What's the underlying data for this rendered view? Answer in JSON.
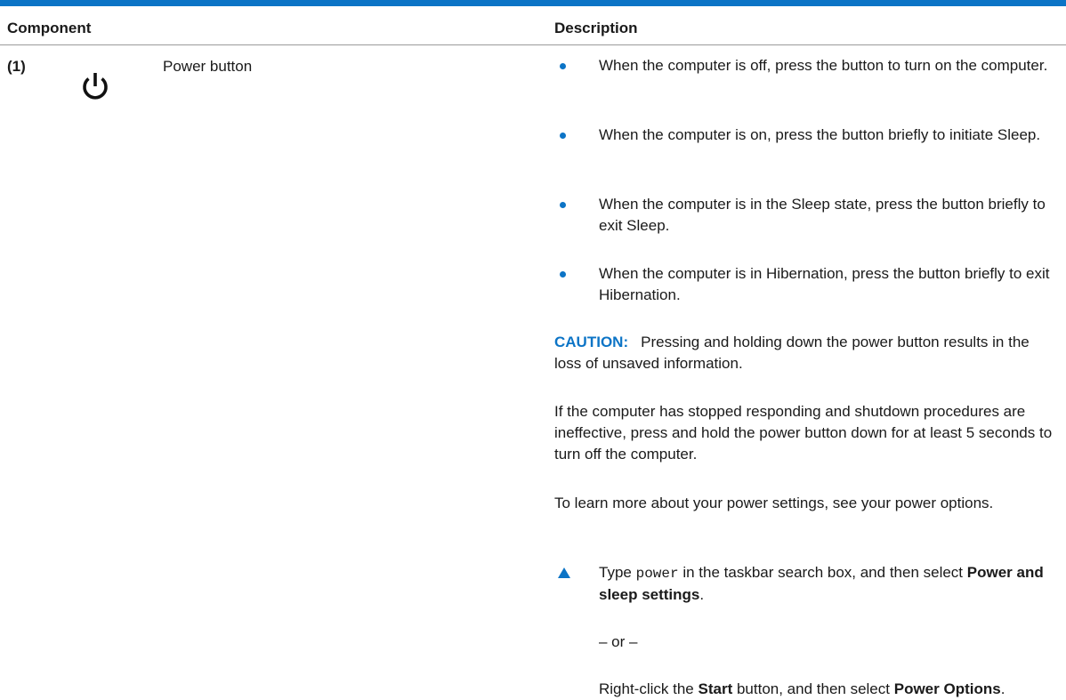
{
  "table": {
    "header": {
      "component": "Component",
      "description": "Description"
    },
    "row": {
      "number": "(1)",
      "icon": "power-icon",
      "name": "Power button"
    }
  },
  "description": {
    "bullets": [
      "When the computer is off, press the button to turn on the computer.",
      "When the computer is on, press the button briefly to initiate Sleep.",
      "When the computer is in the Sleep state, press the button briefly to exit Sleep.",
      "When the computer is in Hibernation, press the button briefly to exit Hibernation."
    ],
    "caution_label": "CAUTION:",
    "caution_text": "Pressing and holding down the power button results in the loss of unsaved information.",
    "unresponsive_text": "If the computer has stopped responding and shutdown procedures are ineffective, press and hold the power button down for at least 5 seconds to turn off the computer.",
    "learn_more_text": "To learn more about your power settings, see your power options.",
    "step1": {
      "prefix": "Type",
      "code": "power",
      "middle": "in the taskbar search box, and then select",
      "bold": "Power and sleep settings",
      "suffix": "."
    },
    "or_text": "– or –",
    "step2": {
      "prefix": "Right-click the",
      "bold1": "Start",
      "middle": "button, and then select",
      "bold2": "Power Options",
      "suffix": "."
    }
  },
  "colors": {
    "accent": "#0c74c6",
    "rule": "#9a9a9a"
  }
}
